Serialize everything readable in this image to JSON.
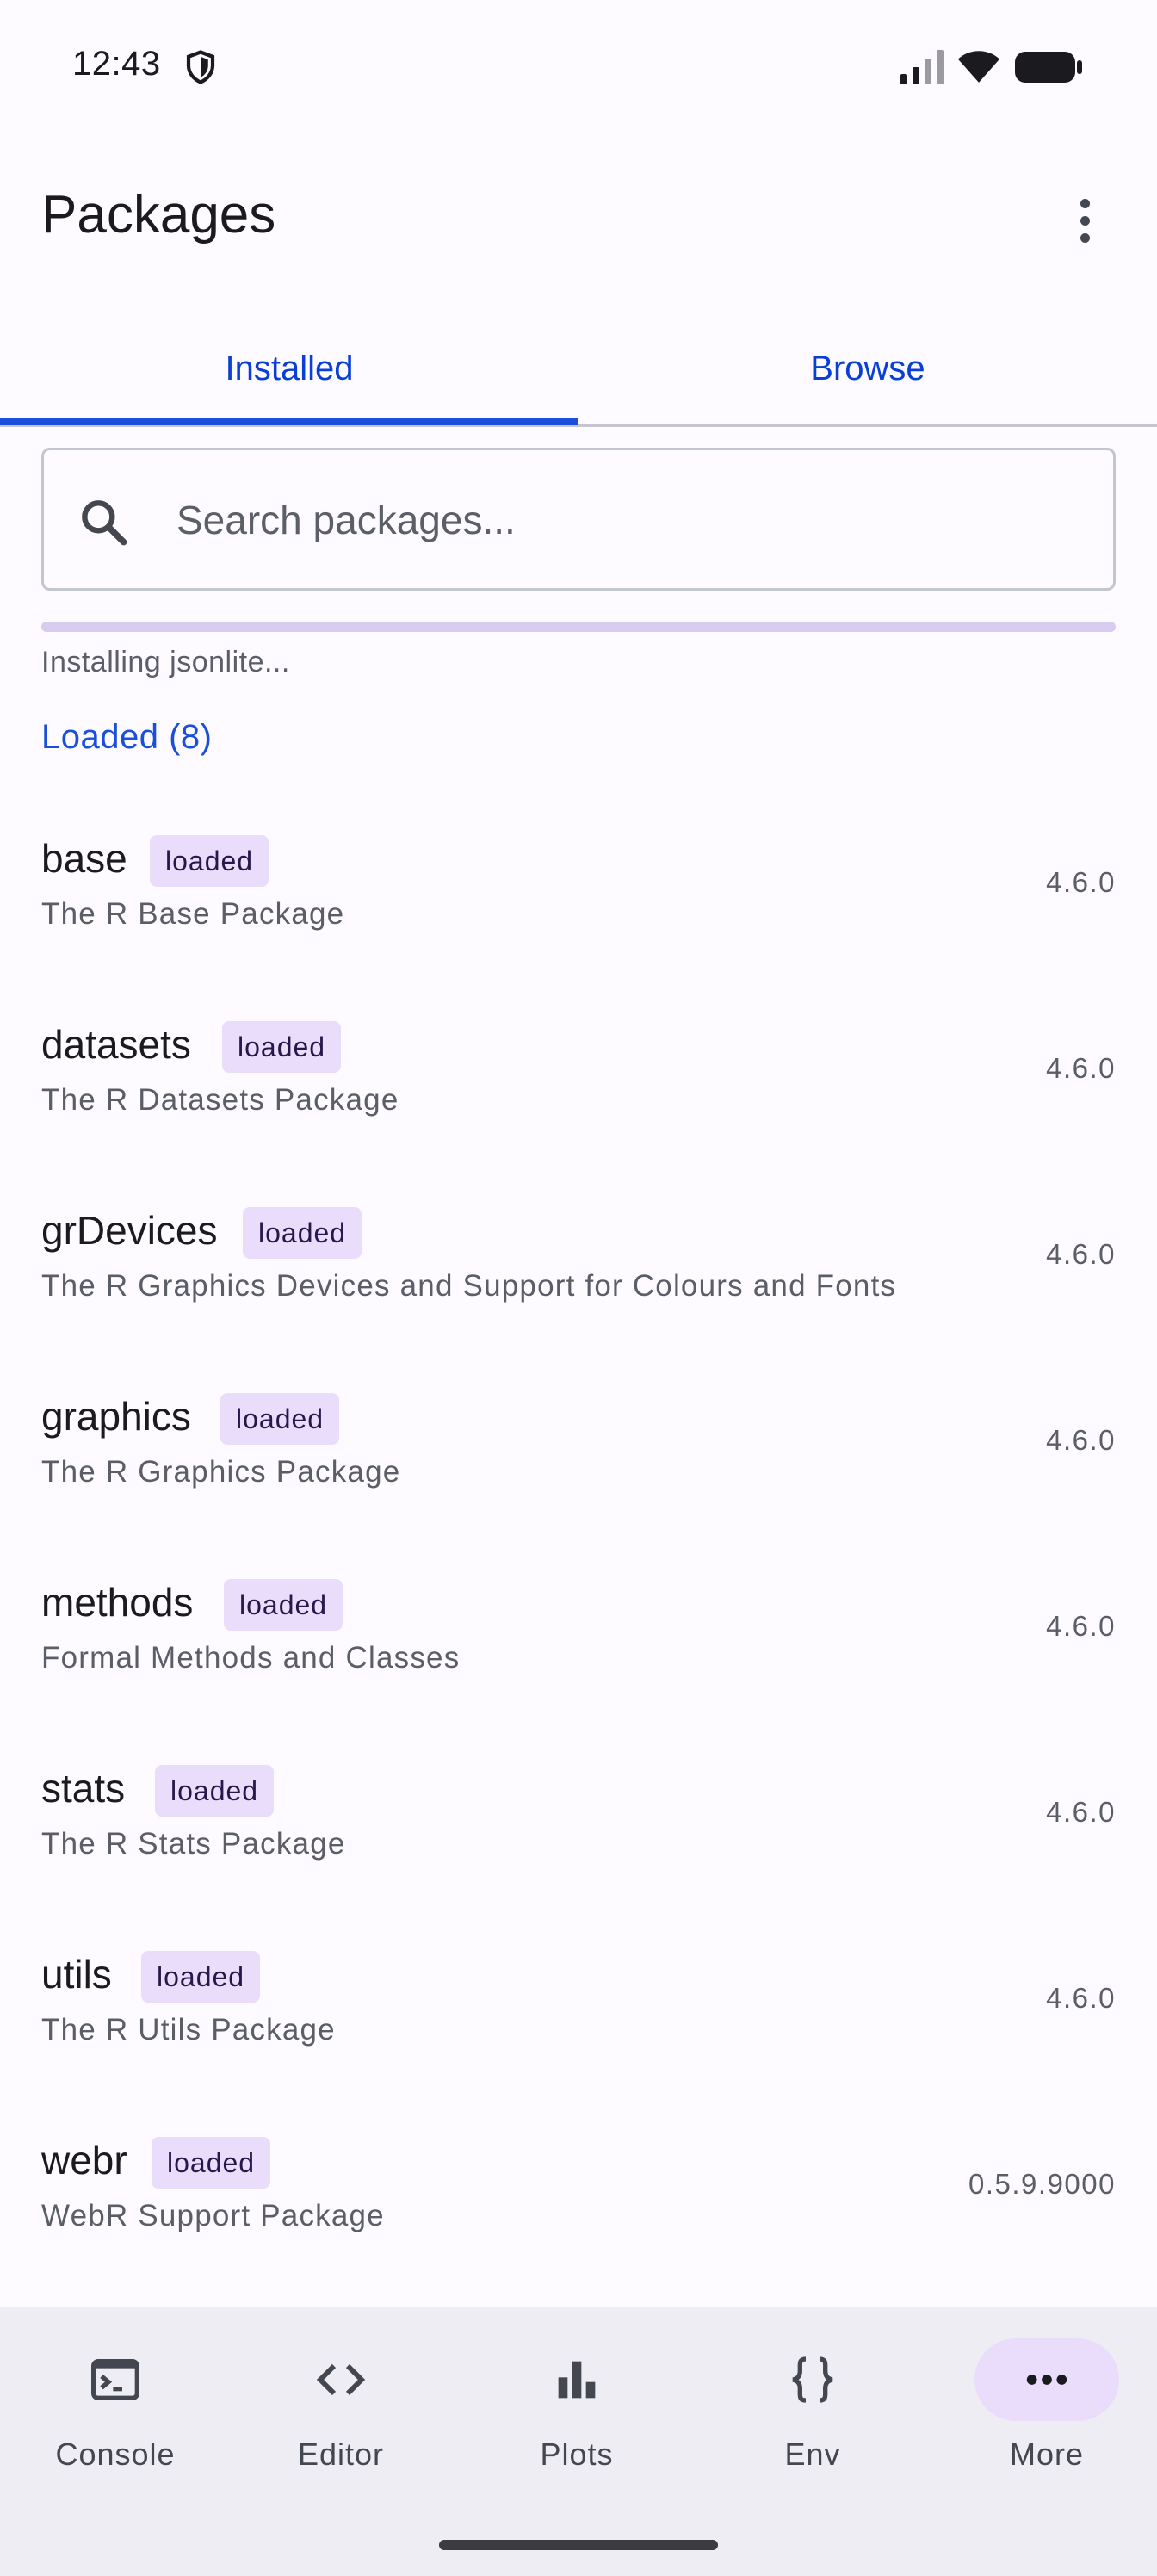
{
  "status_bar": {
    "time": "12:43"
  },
  "app_bar": {
    "title": "Packages"
  },
  "tabs": [
    {
      "label": "Installed",
      "selected": true
    },
    {
      "label": "Browse",
      "selected": false
    }
  ],
  "search": {
    "placeholder": "Search packages...",
    "value": ""
  },
  "progress": {
    "text": "Installing jsonlite..."
  },
  "section": {
    "header": "Loaded (8)"
  },
  "packages": [
    {
      "name": "base",
      "badge": "loaded",
      "description": "The R Base Package",
      "version": "4.6.0"
    },
    {
      "name": "datasets",
      "badge": "loaded",
      "description": "The R Datasets Package",
      "version": "4.6.0"
    },
    {
      "name": "grDevices",
      "badge": "loaded",
      "description": "The R Graphics Devices and Support for Colours and Fonts",
      "version": "4.6.0"
    },
    {
      "name": "graphics",
      "badge": "loaded",
      "description": "The R Graphics Package",
      "version": "4.6.0"
    },
    {
      "name": "methods",
      "badge": "loaded",
      "description": "Formal Methods and Classes",
      "version": "4.6.0"
    },
    {
      "name": "stats",
      "badge": "loaded",
      "description": "The R Stats Package",
      "version": "4.6.0"
    },
    {
      "name": "utils",
      "badge": "loaded",
      "description": "The R Utils Package",
      "version": "4.6.0"
    },
    {
      "name": "webr",
      "badge": "loaded",
      "description": "WebR Support Package",
      "version": "0.5.9.9000"
    }
  ],
  "bottom_nav": [
    {
      "label": "Console",
      "icon": "console-icon",
      "active": false
    },
    {
      "label": "Editor",
      "icon": "code-icon",
      "active": false
    },
    {
      "label": "Plots",
      "icon": "bar-chart-icon",
      "active": false
    },
    {
      "label": "Env",
      "icon": "braces-icon",
      "active": false
    },
    {
      "label": "More",
      "icon": "more-horizontal-icon",
      "active": true
    }
  ],
  "colors": {
    "accent": "#1a4fdc",
    "badge_bg": "#eaddfb",
    "nav_bg": "#efedf4",
    "background": "#fdfbff"
  }
}
